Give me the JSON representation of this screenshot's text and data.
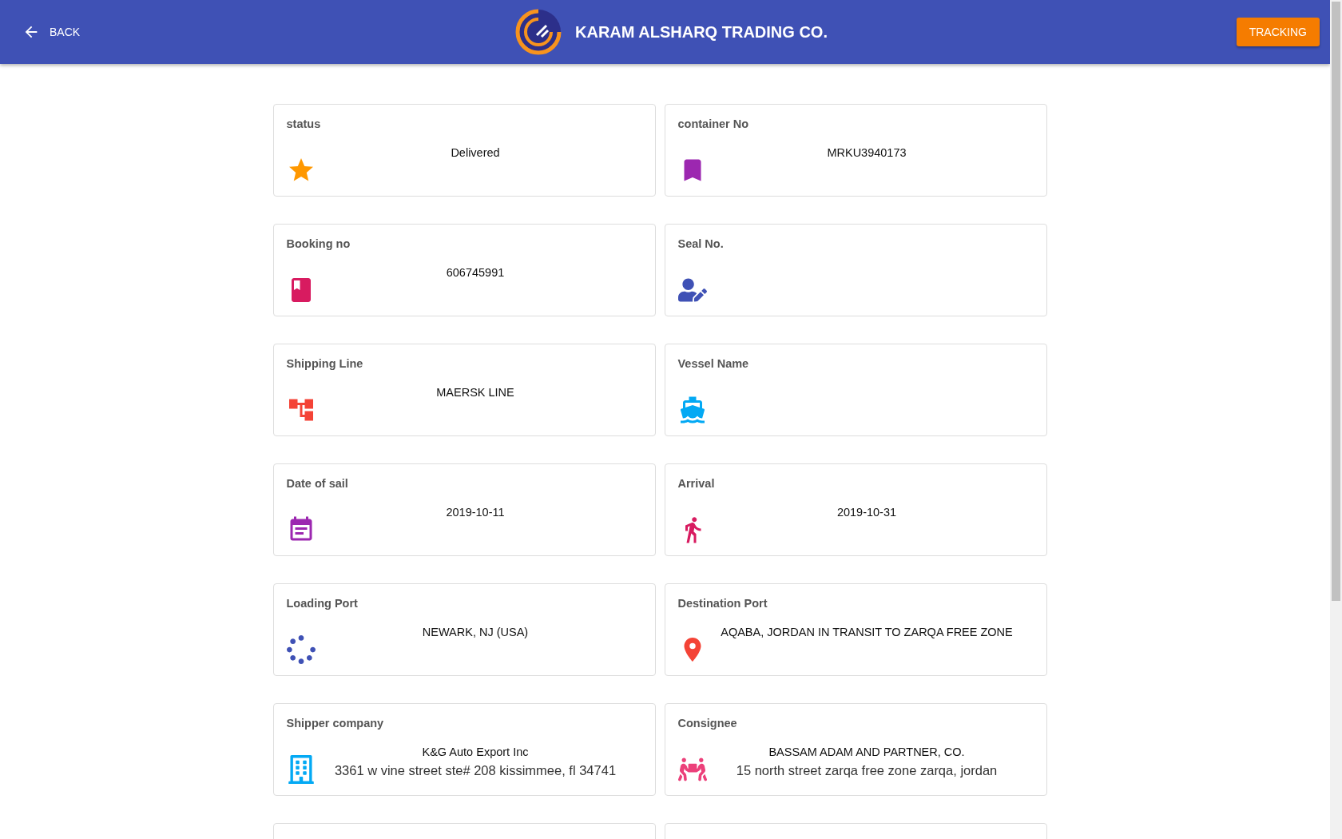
{
  "header": {
    "back_label": "BACK",
    "company_name": "KARAM ALSHARQ TRADING CO.",
    "tracking_button": "TRACKING"
  },
  "fields": [
    {
      "label": "status",
      "value": "Delivered",
      "color": "#ff9800"
    },
    {
      "label": "container No",
      "value": "MRKU3940173",
      "color": "#9c27b0"
    },
    {
      "label": "Booking no",
      "value": "606745991",
      "color": "#d81b60"
    },
    {
      "label": "Seal No.",
      "color": "#3f51b5"
    },
    {
      "label": "Shipping Line",
      "value": "MAERSK LINE",
      "color": "#f44336"
    },
    {
      "label": "Vessel Name",
      "color": "#03a9f4"
    },
    {
      "label": "Date of sail",
      "value": "2019-10-11",
      "color": "#9c27b0"
    },
    {
      "label": "Arrival",
      "value": "2019-10-31",
      "color": "#d81b60"
    },
    {
      "label": "Loading Port",
      "value": "NEWARK, NJ (USA)",
      "color": "#3f51b5"
    },
    {
      "label": "Destination Port",
      "value": "AQABA, JORDAN IN TRANSIT TO ZARQA FREE ZONE",
      "color": "#f44336"
    },
    {
      "label": "Shipper company",
      "value": "K&G Auto Export Inc",
      "detail": "3361 w vine street ste# 208 kissimmee, fl 34741",
      "color": "#03a9f4"
    },
    {
      "label": "Consignee",
      "value": "BASSAM ADAM AND PARTNER, CO.",
      "detail": "15 north street zarqa free zone zarqa, jordan",
      "color": "#ec407a"
    }
  ]
}
